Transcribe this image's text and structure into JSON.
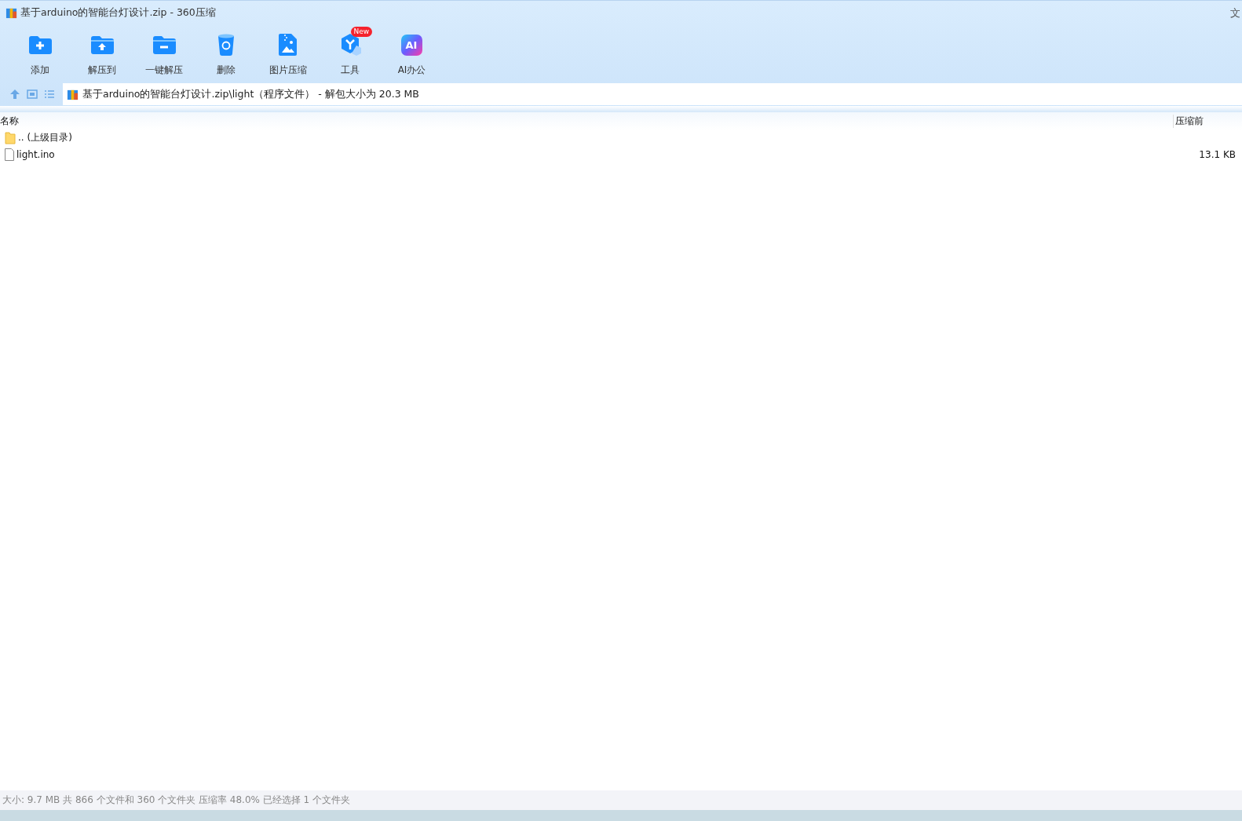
{
  "window": {
    "title": "基于arduino的智能台灯设计.zip - 360压缩",
    "corner_text": "文"
  },
  "toolbar": [
    {
      "kind": "add",
      "label": "添加"
    },
    {
      "kind": "extract",
      "label": "解压到"
    },
    {
      "kind": "quick",
      "label": "一键解压"
    },
    {
      "kind": "delete",
      "label": "删除"
    },
    {
      "kind": "image",
      "label": "图片压缩"
    },
    {
      "kind": "tools",
      "label": "工具",
      "badge": "New"
    },
    {
      "kind": "ai",
      "label": "AI办公",
      "icon_text": "AI"
    }
  ],
  "address": {
    "path": "基于arduino的智能台灯设计.zip\\light（程序文件） - 解包大小为 20.3 MB"
  },
  "table": {
    "columns": [
      "名称",
      "压缩前"
    ],
    "rows": [
      {
        "kind": "folder",
        "name": ".. (上级目录)"
      },
      {
        "kind": "file",
        "name": "light.ino",
        "size": "13.1 KB"
      }
    ]
  },
  "status_bar": "大小: 9.7 MB 共 866 个文件和 360 个文件夹 压缩率 48.0% 已经选择 1 个文件夹"
}
